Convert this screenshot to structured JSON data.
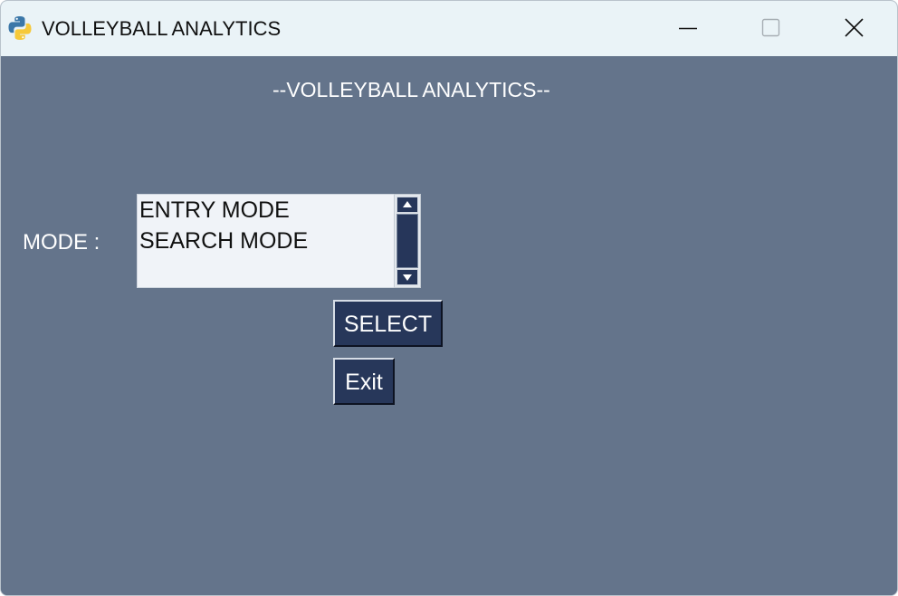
{
  "window": {
    "title": "VOLLEYBALL ANALYTICS",
    "app_icon": "python-icon",
    "controls": {
      "minimize_icon": "minimize-icon",
      "maximize_icon": "maximize-icon",
      "close_icon": "close-icon"
    }
  },
  "main": {
    "heading": "--VOLLEYBALL ANALYTICS--",
    "mode_label": "MODE :",
    "mode_list": {
      "items": [
        "ENTRY MODE",
        "SEARCH MODE"
      ]
    },
    "buttons": {
      "select_label": "SELECT",
      "exit_label": "Exit"
    }
  },
  "colors": {
    "background": "#64748b",
    "titlebar": "#eaf3f7",
    "button": "#27375a",
    "listbox": "#f0f3f8"
  }
}
